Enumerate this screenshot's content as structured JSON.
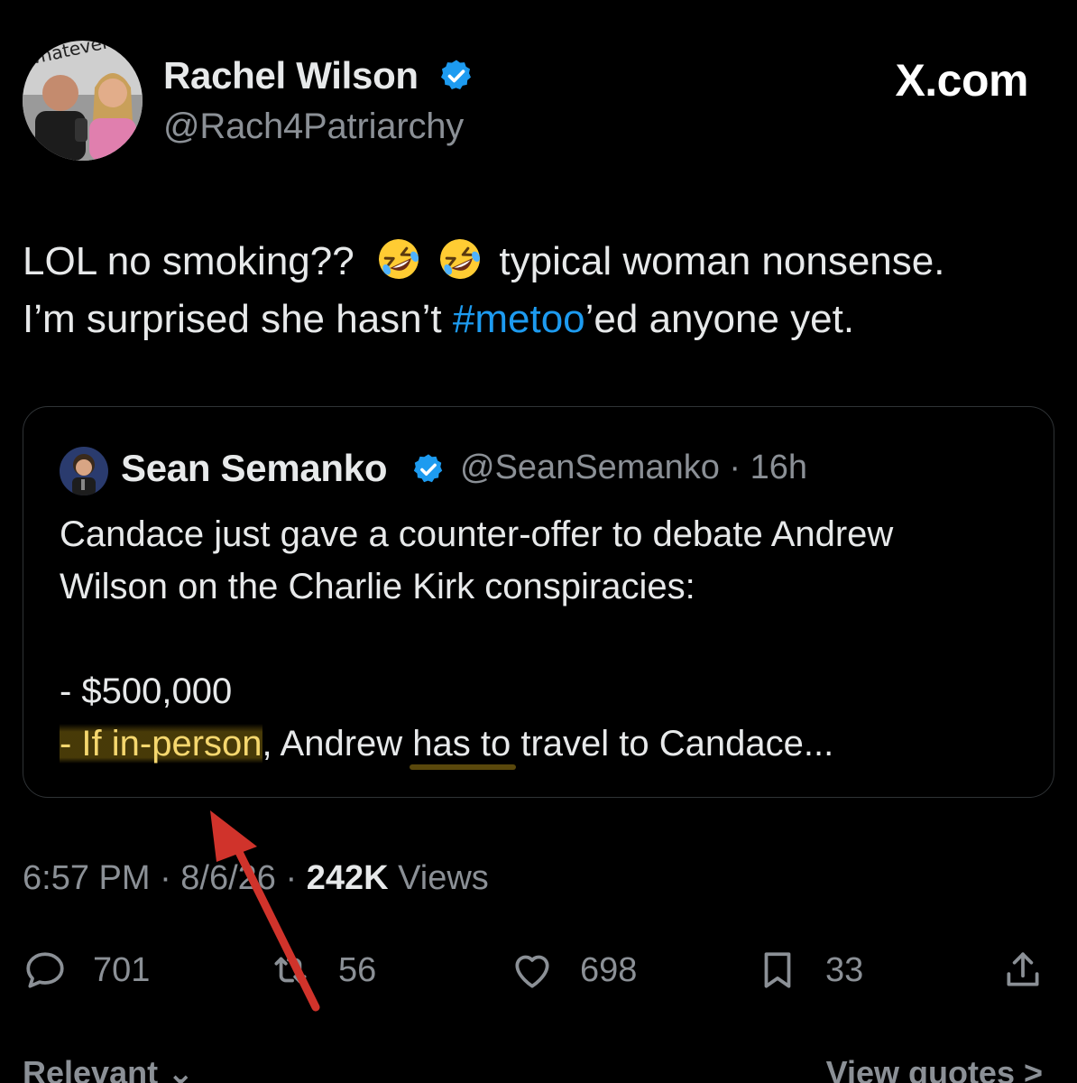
{
  "header": {
    "author_name": "Rachel Wilson",
    "author_handle": "@Rach4Patriarchy",
    "site_label": "X.com",
    "avatar_sign_text": "whatever"
  },
  "tweet": {
    "line1_a": "LOL no smoking??",
    "line1_b": "typical woman nonsense.",
    "line2_a": "I’m surprised she hasn’t ",
    "hashtag": "#metoo",
    "line2_b": "’ed anyone yet.",
    "emoji_name": "rolling-on-the-floor-laughing"
  },
  "quote": {
    "name": "Sean Semanko",
    "handle_time": "@SeanSemanko · 16h",
    "line1": "Candace just gave a counter-offer to debate Andrew",
    "line2": "Wilson on the Charlie Kirk conspiracies:",
    "line3": "- $500,000",
    "line4_hl": "- If in-person",
    "line4_rest": ", Andrew has to travel to Candace..."
  },
  "meta": {
    "time_date": "6:57 PM · 8/6/26 · ",
    "views_count": "242K",
    "views_label": " Views"
  },
  "actions": {
    "replies": "701",
    "reposts": "56",
    "likes": "698",
    "bookmarks": "33"
  },
  "bottom": {
    "sort_label": "Relevant ⌄",
    "quotes_label": "View quotes >"
  },
  "colors": {
    "background": "#000000",
    "text": "#e7e9ea",
    "muted": "#8b9096",
    "link": "#1d9bf0",
    "verified": "#1d9bf0",
    "arrow": "#d0332b",
    "highlight": "#f5d76e"
  }
}
